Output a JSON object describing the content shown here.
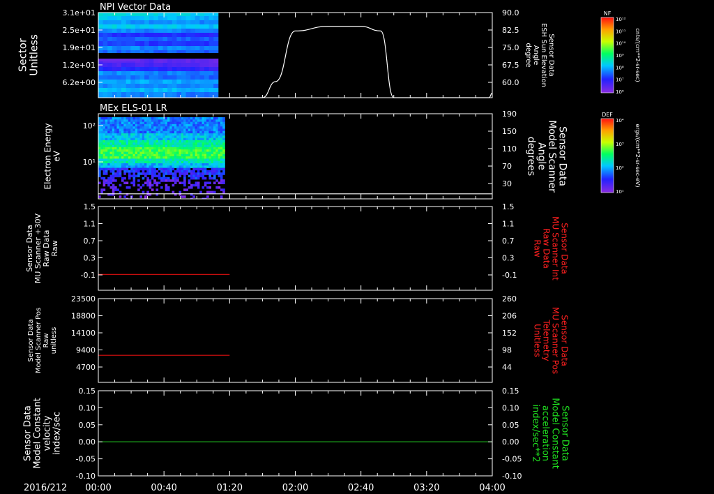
{
  "date_label": "2016/212",
  "time_ticks": [
    "00:00",
    "00:40",
    "01:20",
    "02:00",
    "02:40",
    "03:20",
    "04:00"
  ],
  "colorbars": [
    {
      "label": "NF",
      "unit": "cnts/(cm**2-sr-sec)",
      "ticks": [
        "10¹²",
        "10¹¹",
        "10¹⁰",
        "10⁹",
        "10⁸",
        "10⁷",
        "10⁶"
      ]
    },
    {
      "label": "DEF",
      "unit": "ergs/(cm**2-sr-sec-eV)",
      "ticks": [
        "10⁴",
        "10³",
        "10²",
        "10¹"
      ]
    }
  ],
  "chart_data": [
    {
      "type": "heatmap",
      "title": "NPI Vector Data",
      "ylabel": [
        "Sector",
        "Unitless"
      ],
      "y_ticks": [
        "3.1e+01",
        "2.5e+01",
        "1.9e+01",
        "1.2e+01",
        "6.2e+00"
      ],
      "x_range": [
        "00:00",
        "04:00"
      ],
      "data_extent": [
        "00:00",
        "01:13"
      ],
      "colorbar": "NF",
      "overlay": {
        "type": "line",
        "ylabel": [
          "Sensor Data",
          "ESH Sun Elevation",
          "Angle",
          "degree"
        ],
        "y_ticks": [
          "90.0",
          "82.5",
          "75.0",
          "67.5",
          "60.0"
        ],
        "ylim": [
          53,
          90
        ],
        "color": "#ffffff",
        "x": [
          "01:13",
          "01:40",
          "01:48",
          "02:00",
          "02:20",
          "02:40",
          "02:52",
          "03:00",
          "03:58",
          "04:00"
        ],
        "y": [
          53,
          53,
          60,
          82,
          84,
          84,
          82,
          53,
          53,
          55
        ]
      }
    },
    {
      "type": "heatmap",
      "title": "MEx ELS-01 LR",
      "ylabel": [
        "Electron Energy",
        "eV"
      ],
      "y_ticks": [
        "10²",
        "10¹"
      ],
      "x_range": [
        "00:00",
        "04:00"
      ],
      "data_extent": [
        "00:00",
        "01:17"
      ],
      "colorbar": "DEF",
      "overlay": {
        "type": "line",
        "ylabel": [
          "Sensor Data",
          "Model Scanner",
          "Angle",
          "degrees"
        ],
        "y_ticks": [
          "190",
          "150",
          "110",
          "70",
          "30"
        ],
        "ylim": [
          4,
          190
        ],
        "color": "#ffffff",
        "x": [
          "00:00",
          "04:00"
        ],
        "y": [
          15,
          15
        ]
      }
    },
    {
      "type": "line",
      "ylabel": [
        "Sensor Data",
        "MU Scanner +30V",
        "Raw Data",
        "Raw"
      ],
      "y_ticks": [
        "1.5",
        "1.1",
        "0.7",
        "0.3",
        "-0.1"
      ],
      "ylim": [
        -0.35,
        1.5
      ],
      "right": {
        "ylabel": [
          "Sensor Data",
          "MU Scanner Int",
          "Raw Data",
          "Raw"
        ],
        "y_ticks": [
          "1.5",
          "1.1",
          "0.7",
          "0.3",
          "-0.1"
        ],
        "color": "#ff2020"
      },
      "series": [
        {
          "color": "#e01010",
          "x": [
            "00:00",
            "01:20"
          ],
          "y": [
            0,
            0
          ]
        }
      ]
    },
    {
      "type": "line",
      "ylabel": [
        "Sensor Data",
        "Model Scanner Pos",
        "Raw",
        "unitless"
      ],
      "y_ticks": [
        "23500",
        "18800",
        "14100",
        "9400",
        "4700"
      ],
      "ylim": [
        0,
        23500
      ],
      "right": {
        "ylabel": [
          "Sensor Data",
          "MU Scanner Pos",
          "Telemetry",
          "Unitless"
        ],
        "y_ticks": [
          "260",
          "206",
          "152",
          "98",
          "44"
        ],
        "color": "#ff2020"
      },
      "series": [
        {
          "color": "#e01010",
          "x": [
            "00:00",
            "01:20"
          ],
          "y": [
            7600,
            7600
          ]
        }
      ]
    },
    {
      "type": "line",
      "ylabel": [
        "Sensor Data",
        "Model Constant",
        "velocity",
        "index/sec"
      ],
      "y_ticks": [
        "0.15",
        "0.10",
        "0.05",
        "0.00",
        "-0.05",
        "-0.10"
      ],
      "ylim": [
        -0.1,
        0.15
      ],
      "right": {
        "ylabel": [
          "Sensor Data",
          "Model Constant",
          "acceleration",
          "index/sec**2"
        ],
        "y_ticks": [
          "0.15",
          "0.10",
          "0.05",
          "0.00",
          "-0.05",
          "-0.10"
        ],
        "color": "#20e020"
      },
      "series": [
        {
          "color": "#20c020",
          "x": [
            "00:00",
            "04:00"
          ],
          "y": [
            0,
            0
          ]
        }
      ]
    }
  ]
}
